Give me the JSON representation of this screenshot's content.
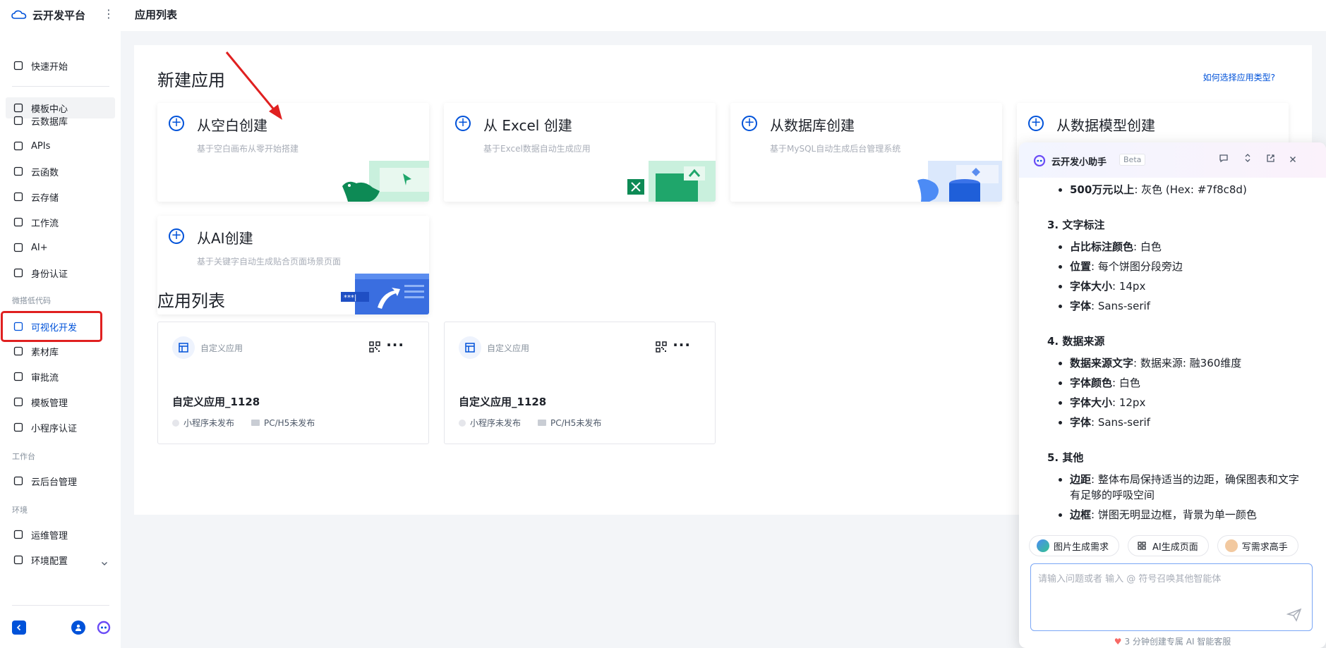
{
  "brand": {
    "name": "云开发平台",
    "more": "⋮"
  },
  "topbar": {
    "title": "应用列表"
  },
  "sidebar": {
    "items_top": [
      {
        "label": "快速开始",
        "icon": "flag-icon"
      },
      {
        "label": "模板中心",
        "icon": "template-icon"
      }
    ],
    "items_main": [
      {
        "label": "云数据库",
        "icon": "database-icon"
      },
      {
        "label": "APIs",
        "icon": "link-icon"
      },
      {
        "label": "云函数",
        "icon": "function-icon"
      },
      {
        "label": "云存储",
        "icon": "folder-icon"
      },
      {
        "label": "工作流",
        "icon": "workflow-icon"
      },
      {
        "label": "AI+",
        "icon": "robot-icon"
      },
      {
        "label": "身份认证",
        "icon": "id-card-icon"
      }
    ],
    "section_lowcode": "微搭低代码",
    "items_lowcode": [
      {
        "label": "可视化开发",
        "icon": "layout-icon"
      },
      {
        "label": "素材库",
        "icon": "shapes-icon"
      },
      {
        "label": "审批流",
        "icon": "stamp-icon"
      },
      {
        "label": "模板管理",
        "icon": "template-icon"
      },
      {
        "label": "小程序认证",
        "icon": "chat-icon"
      }
    ],
    "section_workbench": "工作台",
    "items_workbench": [
      {
        "label": "云后台管理",
        "icon": "laptop-icon"
      }
    ],
    "section_env": "环境",
    "items_env": [
      {
        "label": "运维管理",
        "icon": "chart-icon"
      },
      {
        "label": "环境配置",
        "icon": "cube-icon"
      }
    ]
  },
  "main": {
    "new_app_title": "新建应用",
    "help_link": "如何选择应用类型?",
    "create_cards": [
      {
        "title": "从空白创建",
        "desc": "基于空白画布从零开始搭建"
      },
      {
        "title": "从 Excel 创建",
        "desc": "基于Excel数据自动生成应用"
      },
      {
        "title": "从数据库创建",
        "desc": "基于MySQL自动生成后台管理系统"
      },
      {
        "title": "从数据模型创建",
        "desc": ""
      },
      {
        "title": "从AI创建",
        "desc": "基于关键字自动生成贴合页面场景页面"
      }
    ],
    "app_list_title": "应用列表",
    "apps": [
      {
        "type": "自定义应用",
        "name": "自定义应用_1128",
        "mp_status": "小程序未发布",
        "web_status": "PC/H5未发布"
      },
      {
        "type": "自定义应用",
        "name": "自定义应用_1128",
        "mp_status": "小程序未发布",
        "web_status": "PC/H5未发布"
      }
    ]
  },
  "assistant": {
    "title": "云开发小助手",
    "beta": "Beta",
    "content": {
      "first_item": {
        "bold": "500万元以上",
        "text": ": 灰色 (Hex: #7f8c8d)"
      },
      "sections": [
        {
          "heading": "3. 文字标注",
          "items": [
            {
              "bold": "占比标注颜色",
              "text": ": 白色"
            },
            {
              "bold": "位置",
              "text": ": 每个饼图分段旁边"
            },
            {
              "bold": "字体大小",
              "text": ": 14px"
            },
            {
              "bold": "字体",
              "text": ": Sans-serif"
            }
          ]
        },
        {
          "heading": "4. 数据来源",
          "items": [
            {
              "bold": "数据来源文字",
              "text": ": 数据来源: 融360维度"
            },
            {
              "bold": "字体颜色",
              "text": ": 白色"
            },
            {
              "bold": "字体大小",
              "text": ": 12px"
            },
            {
              "bold": "字体",
              "text": ": Sans-serif"
            }
          ]
        },
        {
          "heading": "5. 其他",
          "items": [
            {
              "bold": "边距",
              "text": ": 整体布局保持适当的边距，确保图表和文字有足够的呼吸空间"
            },
            {
              "bold": "边框",
              "text": ": 饼图无明显边框，背景为单一颜色"
            }
          ]
        }
      ]
    },
    "chips": [
      {
        "label": "图片生成需求"
      },
      {
        "label": "AI生成页面"
      },
      {
        "label": "写需求高手"
      }
    ],
    "input_placeholder": "请输入问题或者 输入 @ 符号召唤其他智能体",
    "footer": "3 分钟创建专属 AI 智能客服"
  },
  "colors": {
    "primary": "#0052d9",
    "highlight": "#e02020"
  }
}
